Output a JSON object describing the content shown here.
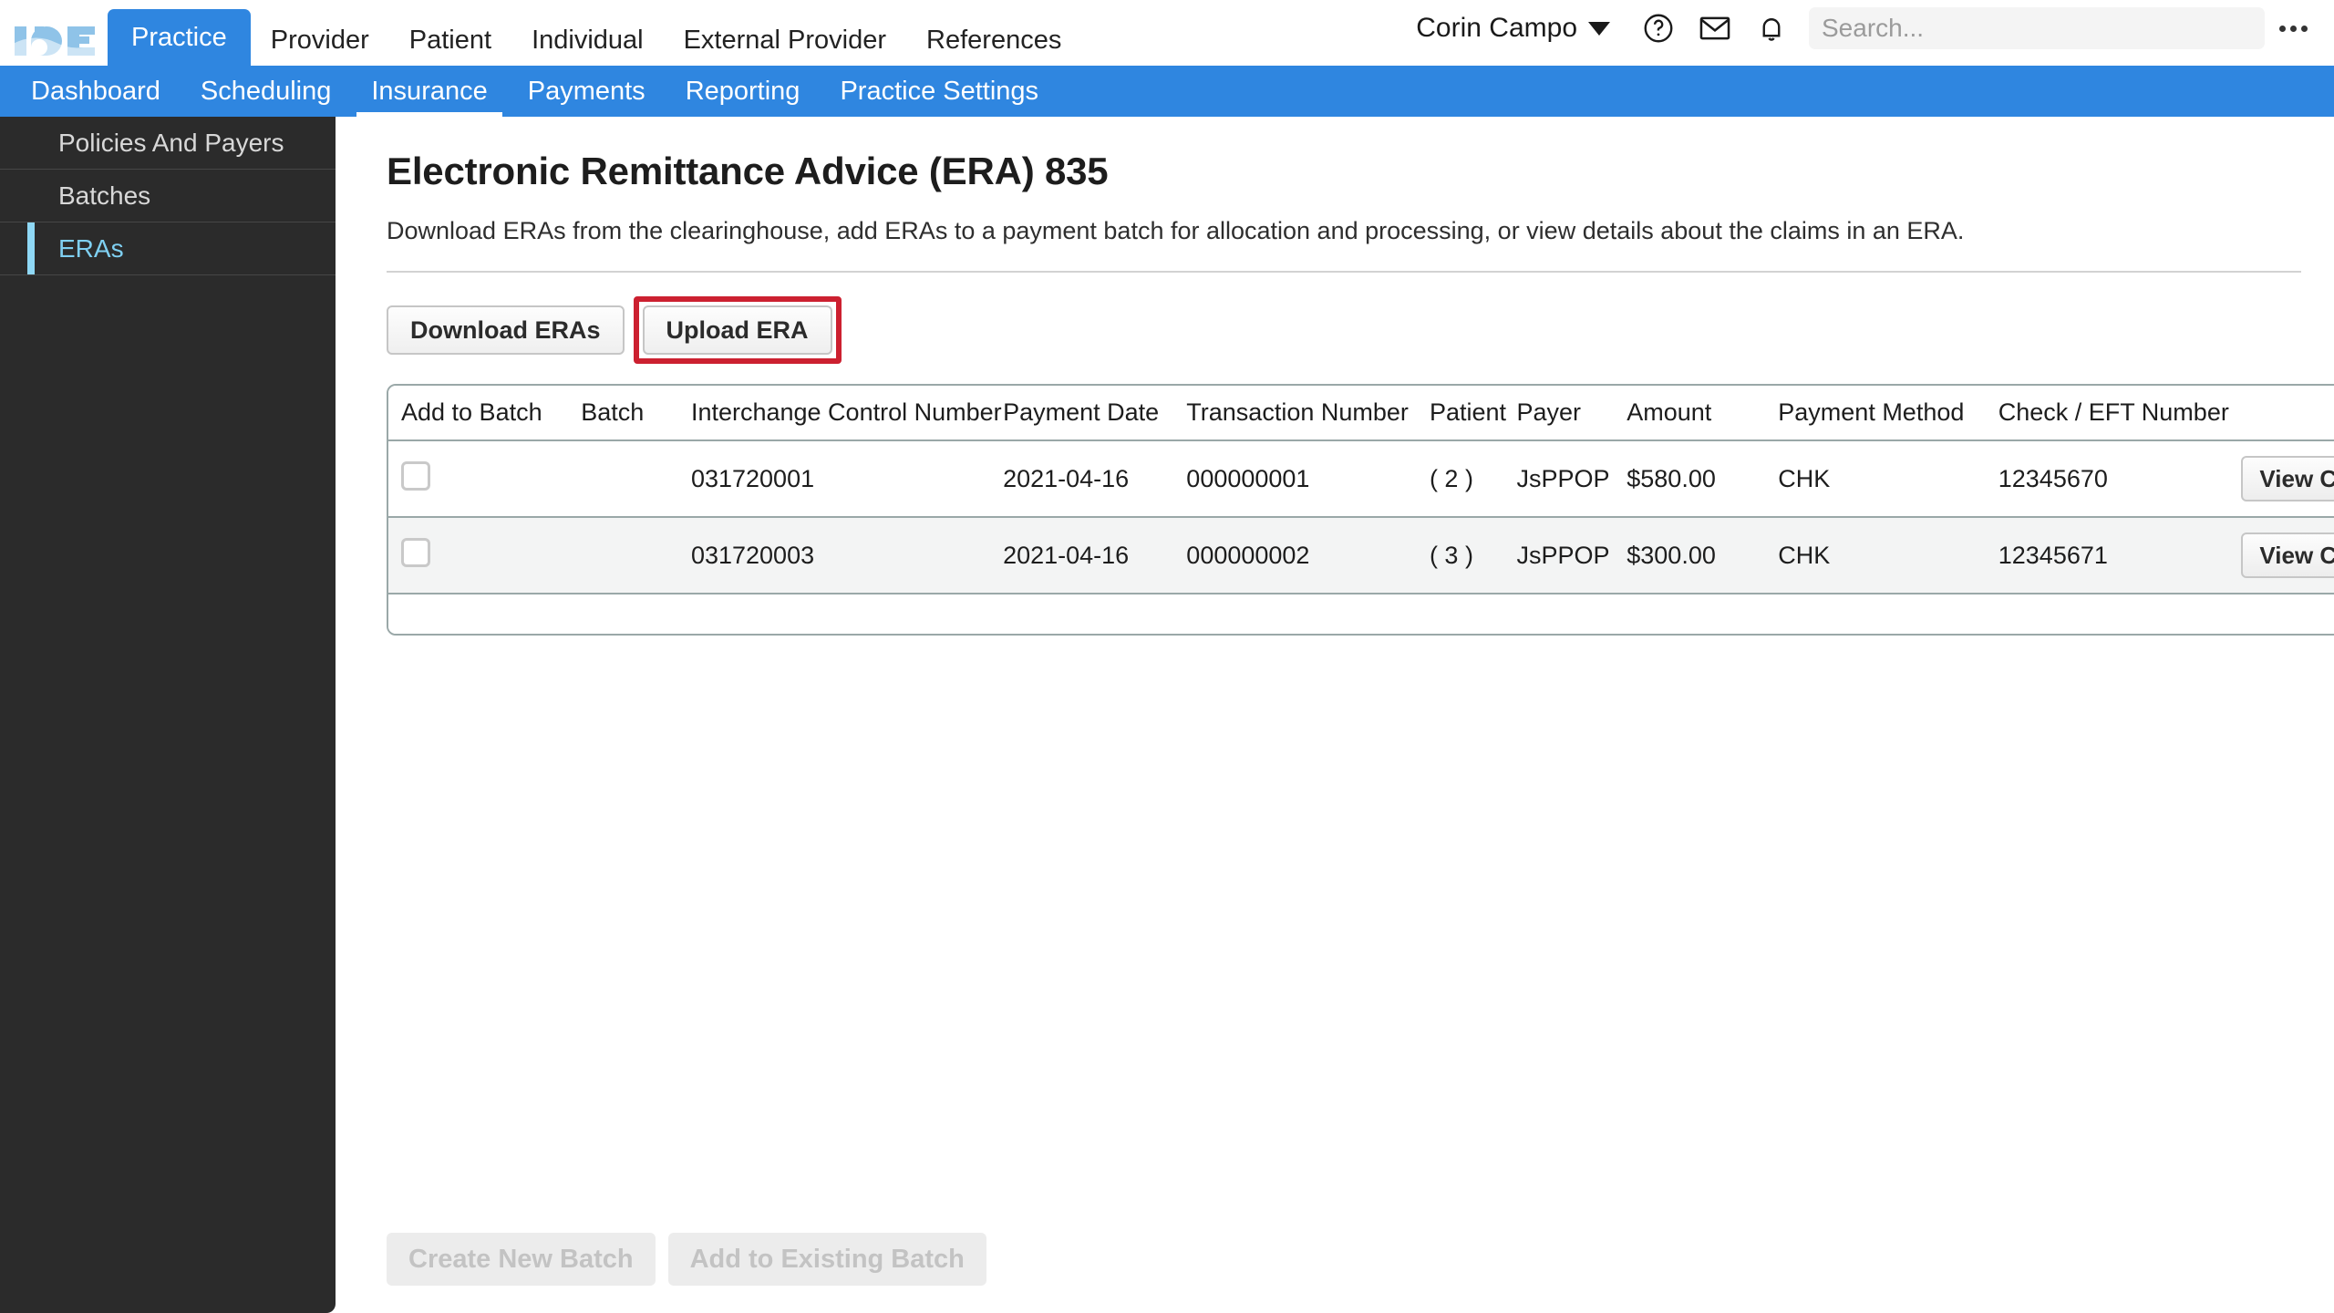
{
  "brand": {
    "logo_text": "ICE"
  },
  "topnav": {
    "tabs": [
      {
        "label": "Practice",
        "active": true
      },
      {
        "label": "Provider",
        "active": false
      },
      {
        "label": "Patient",
        "active": false
      },
      {
        "label": "Individual",
        "active": false
      },
      {
        "label": "External Provider",
        "active": false
      },
      {
        "label": "References",
        "active": false
      }
    ],
    "user": "Corin Campo",
    "help_icon": "help-circle-icon",
    "mail_icon": "envelope-icon",
    "bell_icon": "bell-icon",
    "search_placeholder": "Search...",
    "search_value": "",
    "overflow_icon": "kebab-icon"
  },
  "subnav": {
    "tabs": [
      {
        "label": "Dashboard",
        "active": false
      },
      {
        "label": "Scheduling",
        "active": false
      },
      {
        "label": "Insurance",
        "active": true
      },
      {
        "label": "Payments",
        "active": false
      },
      {
        "label": "Reporting",
        "active": false
      },
      {
        "label": "Practice Settings",
        "active": false
      }
    ]
  },
  "sidebar": {
    "items": [
      {
        "label": "Policies And Payers",
        "active": false
      },
      {
        "label": "Batches",
        "active": false
      },
      {
        "label": "ERAs",
        "active": true
      }
    ]
  },
  "main": {
    "title": "Electronic Remittance Advice (ERA) 835",
    "description": "Download ERAs from the clearinghouse, add ERAs to a payment batch for allocation and processing, or view details about the claims in an ERA.",
    "download_button": "Download ERAs",
    "upload_button": "Upload ERA",
    "upload_button_highlight_color": "#cc2030",
    "table": {
      "columns": [
        "Add to Batch",
        "Batch",
        "Interchange Control Number",
        "Payment Date",
        "Transaction Number",
        "Patient",
        "Payer",
        "Amount",
        "Payment Method",
        "Check / EFT Number",
        ""
      ],
      "rows": [
        {
          "checked": false,
          "batch": "",
          "interchange_control_number": "031720001",
          "payment_date": "2021-04-16",
          "transaction_number": "000000001",
          "patient": "( 2 )",
          "payer": "JsPPOP",
          "amount": "$580.00",
          "payment_method": "CHK",
          "check_eft_number": "12345670",
          "action": "View Claims"
        },
        {
          "checked": false,
          "batch": "",
          "interchange_control_number": "031720003",
          "payment_date": "2021-04-16",
          "transaction_number": "000000002",
          "patient": "( 3 )",
          "payer": "JsPPOP",
          "amount": "$300.00",
          "payment_method": "CHK",
          "check_eft_number": "12345671",
          "action": "View Claims"
        }
      ]
    },
    "footer": {
      "create_new_batch": "Create New Batch",
      "add_to_existing_batch": "Add to Existing Batch"
    }
  },
  "colors": {
    "accent_blue": "#2f86e0",
    "sidebar_bg": "#2b2b2b",
    "sidebar_active_text": "#7fd0f2",
    "highlight_red": "#cc2030"
  }
}
